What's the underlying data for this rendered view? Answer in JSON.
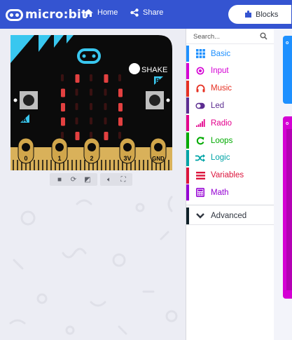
{
  "header": {
    "logo_text": "micro:bit",
    "nav_home_label": "Home",
    "nav_share_label": "Share",
    "blocks_label": "Blocks",
    "color": "#3454d1"
  },
  "simulator": {
    "shake_label": "SHAKE",
    "button_a_label": "A",
    "button_b_label": "B",
    "pins": [
      "0",
      "1",
      "2",
      "3V",
      "GND"
    ],
    "led_rows": [
      [
        0,
        1,
        0,
        1,
        0
      ],
      [
        1,
        0,
        0,
        0,
        1
      ],
      [
        1,
        0,
        0,
        0,
        1
      ],
      [
        1,
        0,
        0,
        0,
        1
      ],
      [
        0,
        1,
        0,
        1,
        0
      ]
    ],
    "led_color": "#e34040",
    "board_color": "#0b0b0b",
    "accent_color": "#39c7ef",
    "pin_color": "#d1a64b",
    "controls": [
      "stop-icon",
      "restart-icon",
      "slowmo-icon",
      "mute-icon",
      "fullscreen-icon"
    ]
  },
  "toolbox": {
    "search_placeholder": "Search...",
    "categories": [
      {
        "label": "Basic",
        "color": "#1e90ff",
        "icon": "grid-icon"
      },
      {
        "label": "Input",
        "color": "#d400d4",
        "icon": "target-icon"
      },
      {
        "label": "Music",
        "color": "#e63022",
        "icon": "headphones-icon"
      },
      {
        "label": "Led",
        "color": "#5c2d91",
        "icon": "toggle-icon"
      },
      {
        "label": "Radio",
        "color": "#e3008c",
        "icon": "signal-icon"
      },
      {
        "label": "Loops",
        "color": "#00aa00",
        "icon": "loop-icon"
      },
      {
        "label": "Logic",
        "color": "#00a4a6",
        "icon": "shuffle-icon"
      },
      {
        "label": "Variables",
        "color": "#dc143c",
        "icon": "list-icon"
      },
      {
        "label": "Math",
        "color": "#9400d3",
        "icon": "calculator-icon"
      }
    ],
    "advanced_label": "Advanced"
  }
}
